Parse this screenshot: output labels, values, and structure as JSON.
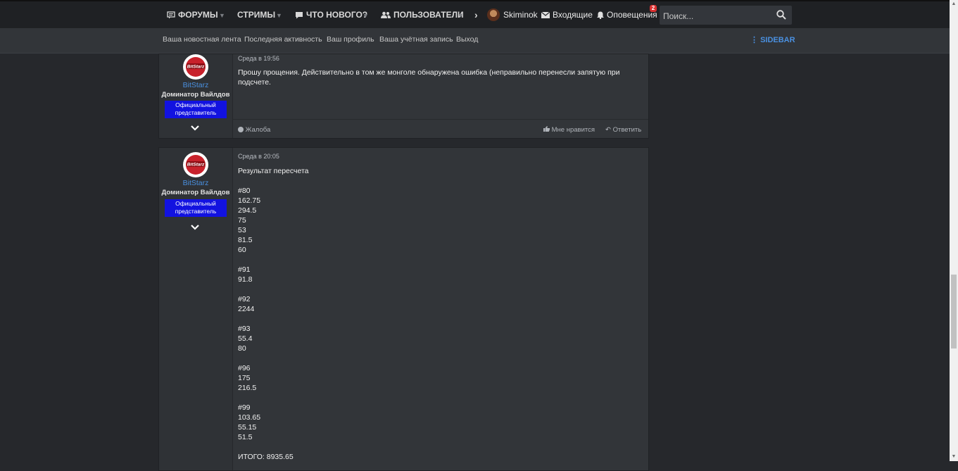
{
  "nav": {
    "forums": "ФОРУМЫ",
    "streams": "СТРИМЫ",
    "whats_new": "ЧТО НОВОГО?",
    "users": "ПОЛЬЗОВАТЕЛИ",
    "username": "Skiminok",
    "inbox": "Входящие",
    "alerts": "Оповещения",
    "alerts_count": "2",
    "search_placeholder": "Поиск..."
  },
  "subnav": {
    "feed": "Ваша новостная лента",
    "activity": "Последняя активность",
    "profile": "Ваш профиль",
    "account": "Ваша учётная запись",
    "logout": "Выход",
    "sidebar": "SIDEBAR"
  },
  "posts": [
    {
      "author": "BitStarz",
      "title": "Доминатор Вайлдов",
      "badge": "Официальный представитель",
      "date": "Среда в 19:56",
      "body": "Прошу прощения. Действительно в том же монголе обнаружена ошибка (неправильно перенесли запятую при подсчете.",
      "report": "Жалоба",
      "like": "Мне нравится",
      "reply": "Ответить"
    },
    {
      "author": "BitStarz",
      "title": "Доминатор Вайлдов",
      "badge": "Официальный представитель",
      "date": "Среда в 20:05",
      "body": "Результат пересчета\n\n#80\n162.75\n294.5\n75\n53\n81.5\n60\n\n#91\n91.8\n\n#92\n2244\n\n#93\n55.4\n80\n\n#96\n175\n216.5\n\n#99\n103.65\n55.15\n51.5\n\nИТОГО: 8935.65"
    }
  ],
  "colors": {
    "accent": "#4a90e0",
    "badge_bg": "#1212e0",
    "alert_badge": "#d93030"
  }
}
